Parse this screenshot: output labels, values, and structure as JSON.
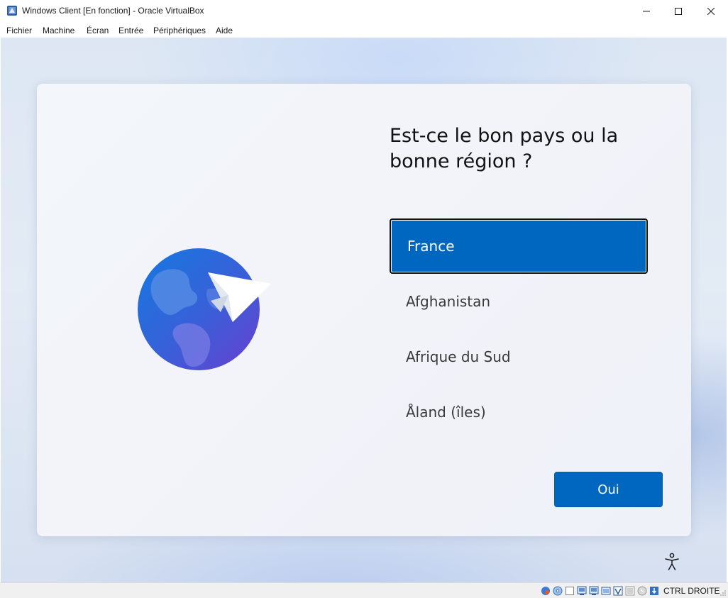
{
  "window": {
    "title": "Windows Client [En fonction] - Oracle VirtualBox"
  },
  "menu": {
    "items": [
      "Fichier",
      "Machine",
      "Écran",
      "Entrée",
      "Périphériques",
      "Aide"
    ]
  },
  "oobe": {
    "question": "Est-ce le bon pays ou la bonne région ?",
    "options": [
      "France",
      "Afghanistan",
      "Afrique du Sud",
      "Åland (îles)"
    ],
    "selected_index": 0,
    "confirm_label": "Oui",
    "accent_color": "#0067c0"
  },
  "statusbar": {
    "host_key_label": "CTRL DROITE",
    "icons": [
      "hard-disk-icon",
      "optical-drive-icon",
      "audio-icon",
      "network-icon",
      "usb-icon",
      "shared-folders-icon",
      "display-icon",
      "recording-icon",
      "mouse-integration-icon",
      "keyboard-capture-icon"
    ]
  }
}
